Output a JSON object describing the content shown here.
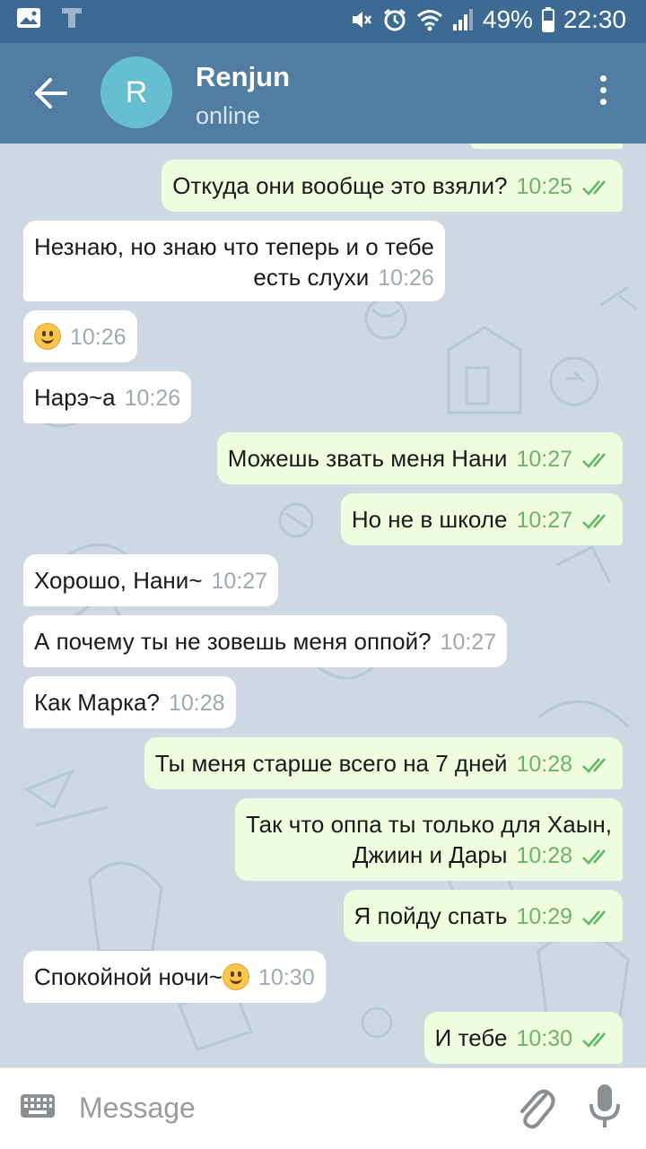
{
  "status_bar": {
    "battery": "49%",
    "time": "22:30",
    "icons": [
      "image-icon",
      "t-icon",
      "mute-icon",
      "alarm-icon",
      "wifi-icon",
      "signal-icon",
      "battery-icon"
    ]
  },
  "header": {
    "avatar_letter": "R",
    "name": "Renjun",
    "status": "online",
    "colors": {
      "bar": "#527da3",
      "avatar": "#65bfd0"
    }
  },
  "messages": [
    {
      "dir": "out",
      "text": "Откуда они вообще это взяли?",
      "time": "10:25",
      "read": true
    },
    {
      "dir": "in",
      "text": "Незнаю, но знаю что теперь и о тебе",
      "text2": "есть слухи",
      "time": "10:26"
    },
    {
      "dir": "in",
      "emoji": "grinning-face",
      "time": "10:26"
    },
    {
      "dir": "in",
      "text": "Нарэ~а",
      "time": "10:26"
    },
    {
      "dir": "out",
      "text": "Можешь звать меня Нани",
      "time": "10:27",
      "read": true
    },
    {
      "dir": "out",
      "text": "Но не в школе",
      "time": "10:27",
      "read": true
    },
    {
      "dir": "in",
      "text": "Хорошо, Нани~",
      "time": "10:27"
    },
    {
      "dir": "in",
      "text": "А почему ты не зовешь меня оппой?",
      "time": "10:27"
    },
    {
      "dir": "in",
      "text": "Как Марка?",
      "time": "10:28"
    },
    {
      "dir": "out",
      "text": "Ты меня старше всего на 7 дней",
      "time": "10:28",
      "read": true
    },
    {
      "dir": "out",
      "text": "Так что оппа ты только для Хаын,",
      "text2": "Джиин и Дары",
      "time": "10:28",
      "read": true
    },
    {
      "dir": "out",
      "text": "Я пойду спать",
      "time": "10:29",
      "read": true
    },
    {
      "dir": "in",
      "text": "Спокойной ночи~",
      "emoji": "smiling-face",
      "time": "10:30"
    },
    {
      "dir": "out",
      "text": "И тебе",
      "time": "10:30",
      "read": true
    }
  ],
  "input": {
    "placeholder": "Message"
  },
  "colors": {
    "outgoing_bubble": "#effdde",
    "incoming_bubble": "#ffffff",
    "read_ticks": "#5dbb63"
  }
}
